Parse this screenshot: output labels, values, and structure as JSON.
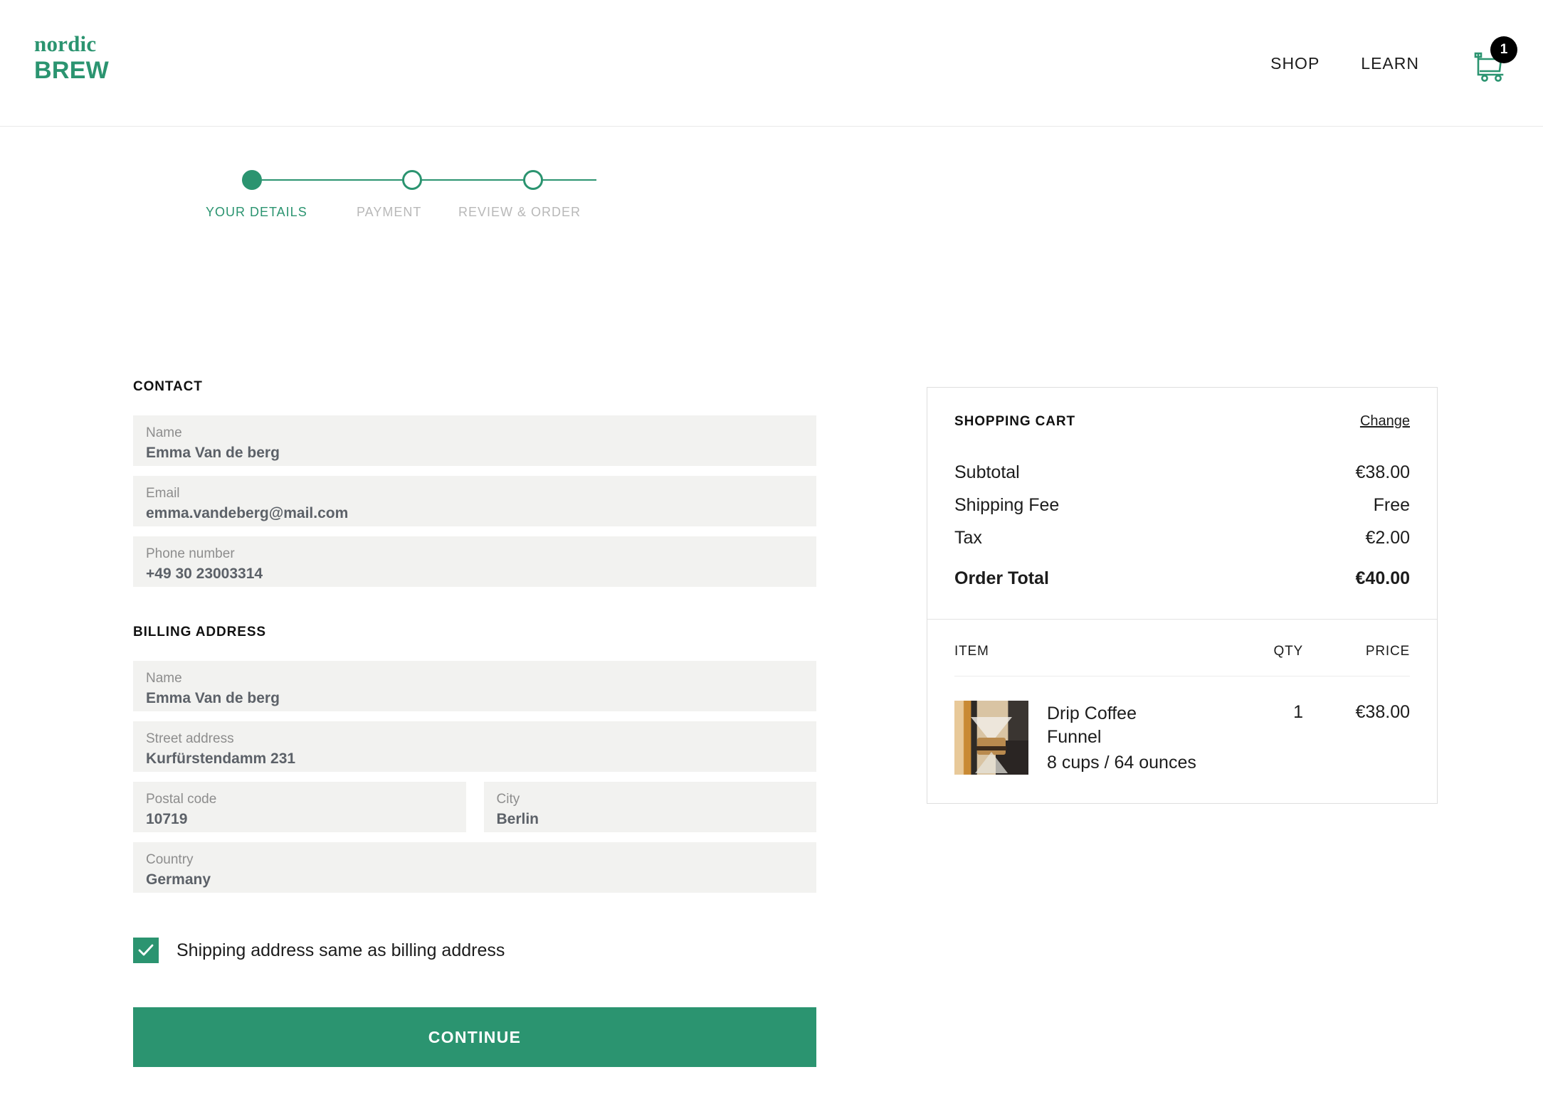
{
  "brand": {
    "logo_top": "nordic",
    "logo_bottom": "BREW",
    "accent_color": "#2b9470"
  },
  "header": {
    "nav": [
      {
        "label": "SHOP"
      },
      {
        "label": "LEARN"
      }
    ],
    "cart_count": "1"
  },
  "stepper": {
    "steps": [
      {
        "label": "YOUR DETAILS",
        "state": "active"
      },
      {
        "label": "PAYMENT",
        "state": "upcoming"
      },
      {
        "label": "REVIEW & ORDER",
        "state": "upcoming"
      }
    ]
  },
  "contact": {
    "title": "CONTACT",
    "fields": [
      {
        "label": "Name",
        "value": "Emma Van de berg"
      },
      {
        "label": "Email",
        "value": "emma.vandeberg@mail.com"
      },
      {
        "label": "Phone number",
        "value": "+49 30 23003314"
      }
    ]
  },
  "billing": {
    "title": "BILLING ADDRESS",
    "name": {
      "label": "Name",
      "value": "Emma Van de berg"
    },
    "street": {
      "label": "Street address",
      "value": "Kurfürstendamm 231"
    },
    "postal": {
      "label": "Postal code",
      "value": "10719"
    },
    "city": {
      "label": "City",
      "value": "Berlin"
    },
    "country": {
      "label": "Country",
      "value": "Germany"
    }
  },
  "shipping_checkbox": {
    "label": "Shipping address same as billing address",
    "checked": true
  },
  "continue_button": {
    "label": "CONTINUE"
  },
  "cart": {
    "title": "SHOPPING CART",
    "change_link": "Change",
    "summary": [
      {
        "label": "Subtotal",
        "value": "€38.00"
      },
      {
        "label": "Shipping Fee",
        "value": "Free"
      },
      {
        "label": "Tax",
        "value": "€2.00"
      }
    ],
    "total": {
      "label": "Order Total",
      "value": "€40.00"
    },
    "columns": {
      "item": "ITEM",
      "qty": "QTY",
      "price": "PRICE"
    },
    "items": [
      {
        "name": "Drip Coffee Funnel",
        "variant": "8 cups / 64 ounces",
        "qty": "1",
        "price": "€38.00"
      }
    ]
  }
}
